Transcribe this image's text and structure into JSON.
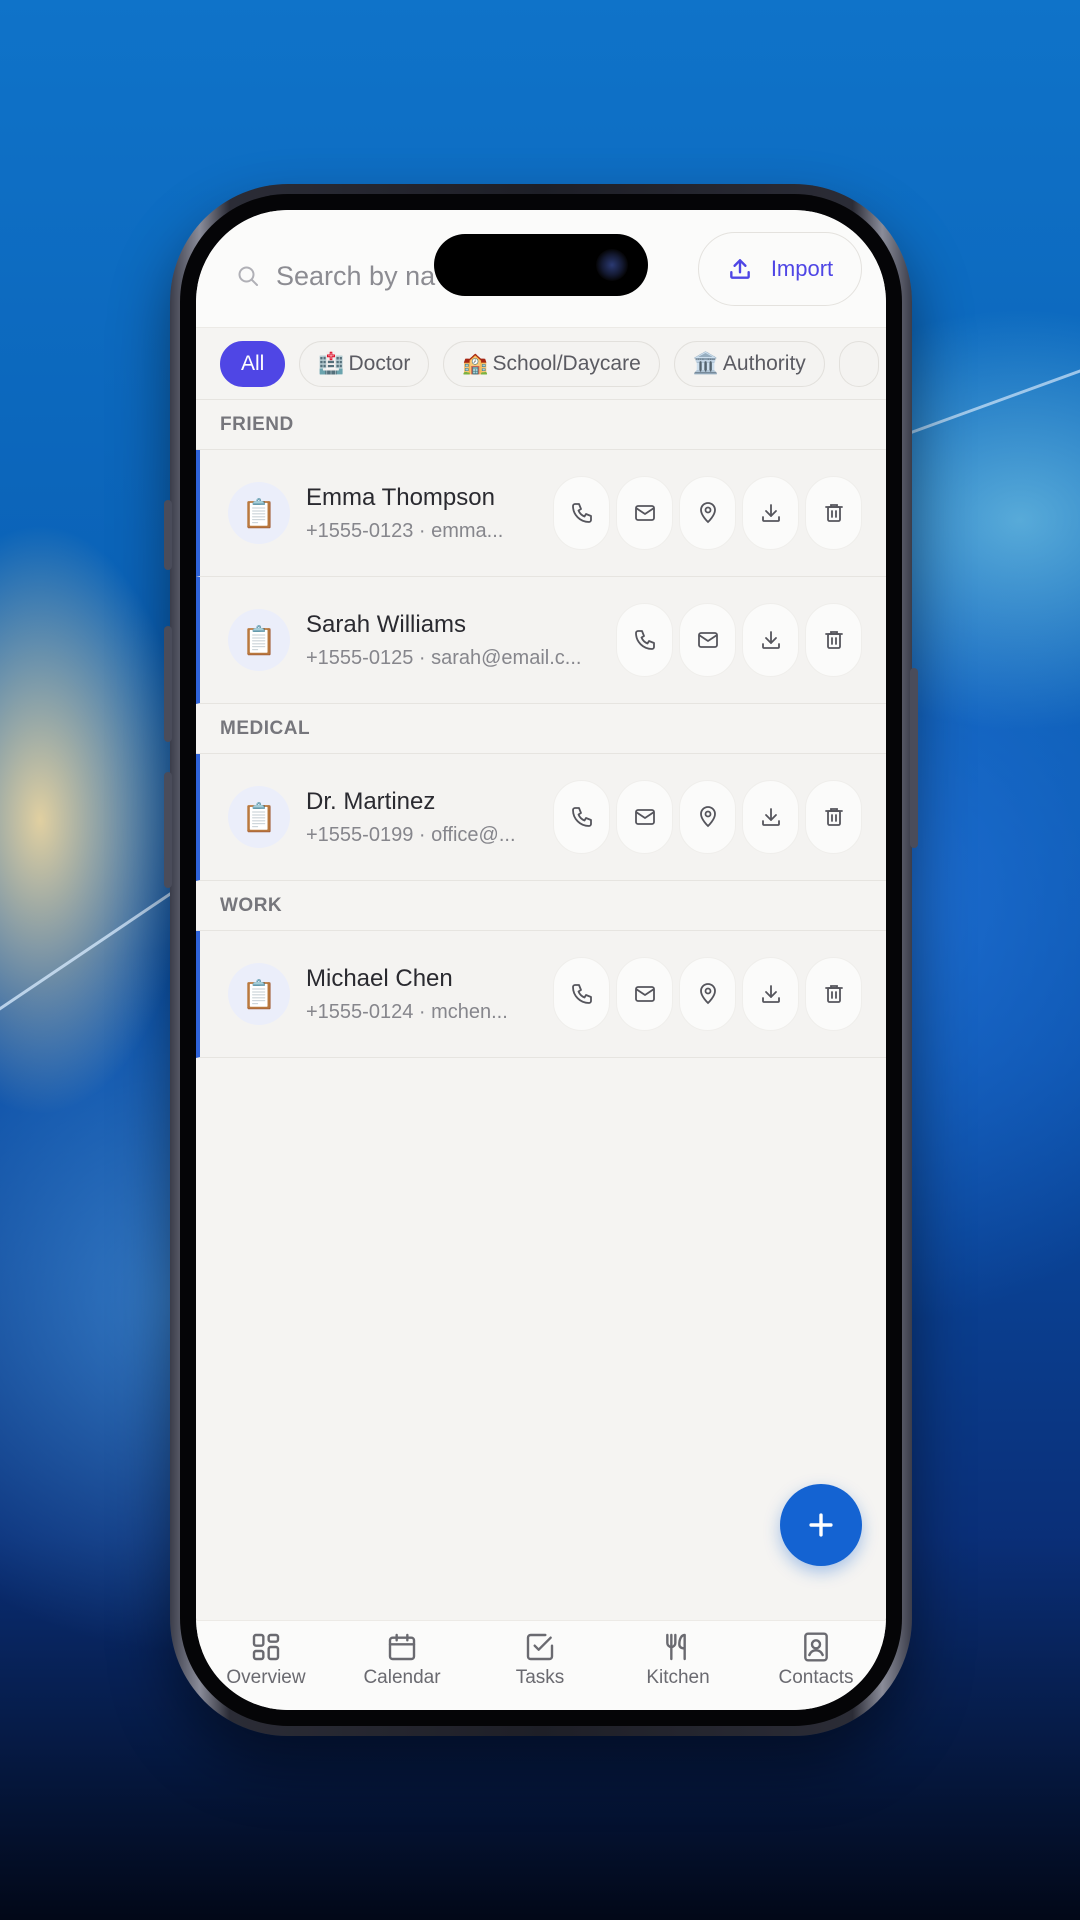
{
  "search": {
    "placeholder": "Search by na",
    "icon": "search-icon"
  },
  "import_button": {
    "label": "Import",
    "icon": "upload-icon"
  },
  "filters": [
    {
      "label": "All",
      "emoji": "",
      "active": true
    },
    {
      "label": "Doctor",
      "emoji": "🏥",
      "active": false
    },
    {
      "label": "School/Daycare",
      "emoji": "🏫",
      "active": false
    },
    {
      "label": "Authority",
      "emoji": "🏛️",
      "active": false
    }
  ],
  "sections": [
    {
      "title": "FRIEND",
      "contacts": [
        {
          "name": "Emma Thompson",
          "meta": "+1555-0123 · emma...",
          "avatar": "📋",
          "actions": [
            "phone",
            "mail",
            "location",
            "download",
            "delete"
          ]
        },
        {
          "name": "Sarah Williams",
          "meta": "+1555-0125 · sarah@email.c...",
          "avatar": "📋",
          "actions": [
            "phone",
            "mail",
            "download",
            "delete"
          ]
        }
      ]
    },
    {
      "title": "MEDICAL",
      "contacts": [
        {
          "name": "Dr. Martinez",
          "meta": "+1555-0199 · office@...",
          "avatar": "📋",
          "actions": [
            "phone",
            "mail",
            "location",
            "download",
            "delete"
          ]
        }
      ]
    },
    {
      "title": "WORK",
      "contacts": [
        {
          "name": "Michael Chen",
          "meta": "+1555-0124 · mchen...",
          "avatar": "📋",
          "actions": [
            "phone",
            "mail",
            "location",
            "download",
            "delete"
          ]
        }
      ]
    }
  ],
  "fab": {
    "icon": "plus-icon"
  },
  "bottom_nav": [
    {
      "label": "Overview",
      "icon": "grid-icon"
    },
    {
      "label": "Calendar",
      "icon": "calendar-icon"
    },
    {
      "label": "Tasks",
      "icon": "check-square-icon"
    },
    {
      "label": "Kitchen",
      "icon": "utensils-icon"
    },
    {
      "label": "Contacts",
      "icon": "contact-book-icon"
    }
  ],
  "colors": {
    "accent": "#4f46e5",
    "fab": "#1463d2",
    "row_border": "#2f63d9"
  }
}
